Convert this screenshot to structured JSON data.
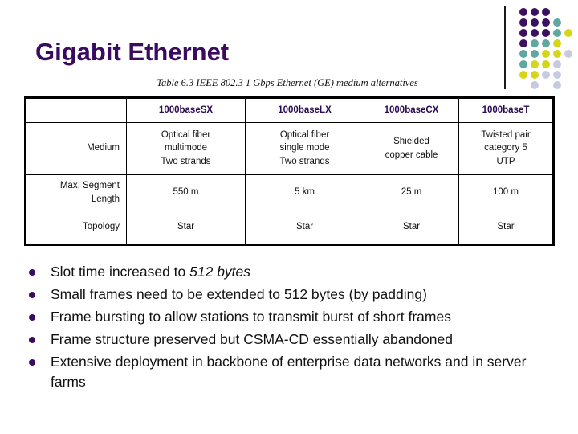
{
  "slide": {
    "title": "Gigabit Ethernet",
    "title_color": "#3B0B60"
  },
  "logo": {
    "name": "dot-grid-logo",
    "colors": {
      "purple": "#3B1060",
      "teal": "#5FA8A0",
      "yellow": "#D6D619",
      "lavender": "#C8CAE0"
    },
    "rows": [
      [
        "purple",
        "purple",
        "purple",
        "empty",
        "empty"
      ],
      [
        "purple",
        "purple",
        "purple",
        "teal",
        "empty"
      ],
      [
        "purple",
        "purple",
        "purple",
        "teal",
        "yellow"
      ],
      [
        "purple",
        "teal",
        "teal",
        "yellow",
        "empty"
      ],
      [
        "teal",
        "teal",
        "yellow",
        "yellow",
        "lavender"
      ],
      [
        "teal",
        "yellow",
        "yellow",
        "lavender",
        "empty"
      ],
      [
        "yellow",
        "yellow",
        "lavender",
        "lavender",
        "empty"
      ],
      [
        "empty",
        "lavender",
        "empty",
        "lavender",
        "empty"
      ]
    ]
  },
  "table": {
    "caption": "Table 6.3  IEEE 802.3 1 Gbps Ethernet (GE) medium alternatives",
    "headers": [
      "",
      "1000base SX",
      "1000base LX",
      "1000base CX",
      "1000base T"
    ],
    "header_labels": {
      "corner": "",
      "sx": "1000baseSX",
      "lx": "1000baseLX",
      "cx": "1000baseCX",
      "t": "1000baseT"
    },
    "rows": [
      {
        "label": "Medium",
        "cells": [
          "Optical fiber\nmultimode\nTwo strands",
          "Optical fiber\nsingle mode\nTwo strands",
          "Shielded\ncopper cable",
          "Twisted pair\ncategory 5\nUTP"
        ]
      },
      {
        "label": "Max. Segment Length",
        "cells": [
          "550 m",
          "5 km",
          "25 m",
          "100 m"
        ]
      },
      {
        "label": "Topology",
        "cells": [
          "Star",
          "Star",
          "Star",
          "Star"
        ]
      }
    ]
  },
  "bullets": [
    {
      "pre": "Slot time increased to ",
      "italic": "512 bytes",
      "post": ""
    },
    {
      "pre": "Small frames need to be extended to 512 bytes (by padding)",
      "italic": "",
      "post": ""
    },
    {
      "pre": "Frame bursting to allow stations to transmit burst of short frames",
      "italic": "",
      "post": ""
    },
    {
      "pre": "Frame structure preserved but CSMA-CD essentially abandoned",
      "italic": "",
      "post": ""
    },
    {
      "pre": "Extensive deployment in backbone of enterprise data networks and in server farms",
      "italic": "",
      "post": ""
    }
  ]
}
